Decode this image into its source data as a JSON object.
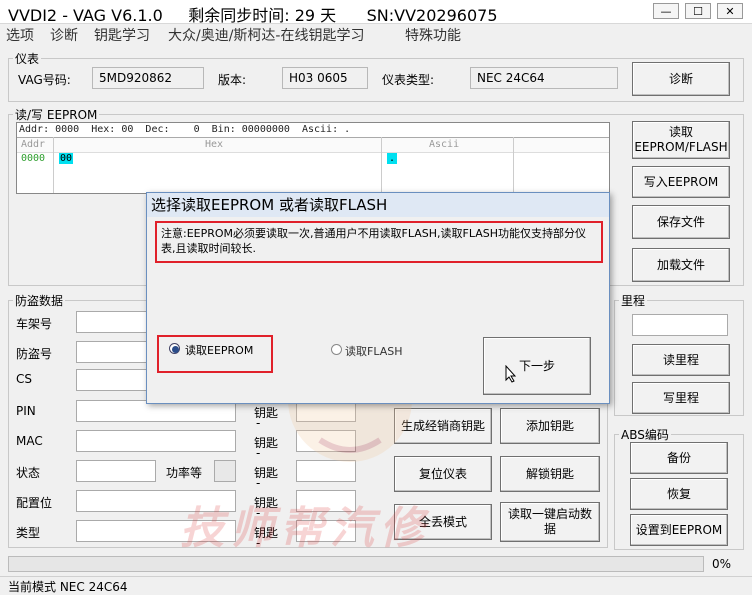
{
  "window": {
    "title": "VVDI2 - VAG V6.1.0     剩余同步时间: 29 天      SN:VV20296075",
    "min_symbol": "—",
    "max_symbol": "☐",
    "close_symbol": "✕"
  },
  "menu": [
    "选项",
    "诊断",
    "钥匙学习",
    "大众/奥迪/斯柯达-在线钥匙学习",
    "特殊功能"
  ],
  "instrument": {
    "legend": "仪表",
    "vag_label": "VAG号码:",
    "vag_value": "5MD920862",
    "version_label": "版本:",
    "version_value": "H03 0605",
    "type_label": "仪表类型:",
    "type_value": "NEC 24C64",
    "diagnose_button": "诊断"
  },
  "eeprom": {
    "legend": "读/写 EEPROM",
    "header_line": "Addr: 0000  Hex: 00  Dec:    0  Bin: 00000000  Ascii: .",
    "col_addr": "Addr",
    "col_hex": "Hex",
    "col_ascii": "Ascii",
    "row_addr": "0000",
    "row_hex": "00",
    "row_ascii": ".",
    "buttons": {
      "read": "读取\nEEPROM/FLASH",
      "write": "写入EEPROM",
      "save": "保存文件",
      "load": "加载文件"
    }
  },
  "immo": {
    "legend": "防盗数据",
    "labels": [
      "车架号",
      "防盗号",
      "CS",
      "PIN",
      "MAC",
      "状态",
      "配置位",
      "类型"
    ],
    "power_label": "功率等",
    "key_label": "钥匙",
    "key_dash": "-"
  },
  "key_actions": {
    "make_dealer_key": "生成经销商钥匙",
    "add_key": "添加钥匙",
    "reset_cluster": "复位仪表",
    "unlock_key": "解锁钥匙",
    "all_keys_lost": "全丢模式",
    "one_key_start": "读取一键启动数据"
  },
  "mileage": {
    "legend": "里程",
    "read": "读里程",
    "write": "写里程"
  },
  "abs": {
    "legend": "ABS编码",
    "backup": "备份",
    "restore": "恢复",
    "set_eeprom": "设置到EEPROM"
  },
  "progress": {
    "value_text": "0%",
    "fraction": 0
  },
  "status_bar": "当前模式 NEC 24C64",
  "dialog": {
    "title": "选择读取EEPROM 或者读取FLASH",
    "note": "注意:EEPROM必须要读取一次,普通用户不用读取FLASH,读取FLASH功能仅支持部分仪表,且读取时间较长.",
    "option_eeprom": "读取EEPROM",
    "option_flash": "读取FLASH",
    "selected": "option_eeprom",
    "next_button": "下一步"
  },
  "watermark": "技师帮汽修",
  "colors": {
    "highlight_red": "#e0202a",
    "cursor_cyan": "#00e0f0",
    "addr_green": "#2e9e2e",
    "dialog_border": "#6a8fbf"
  }
}
